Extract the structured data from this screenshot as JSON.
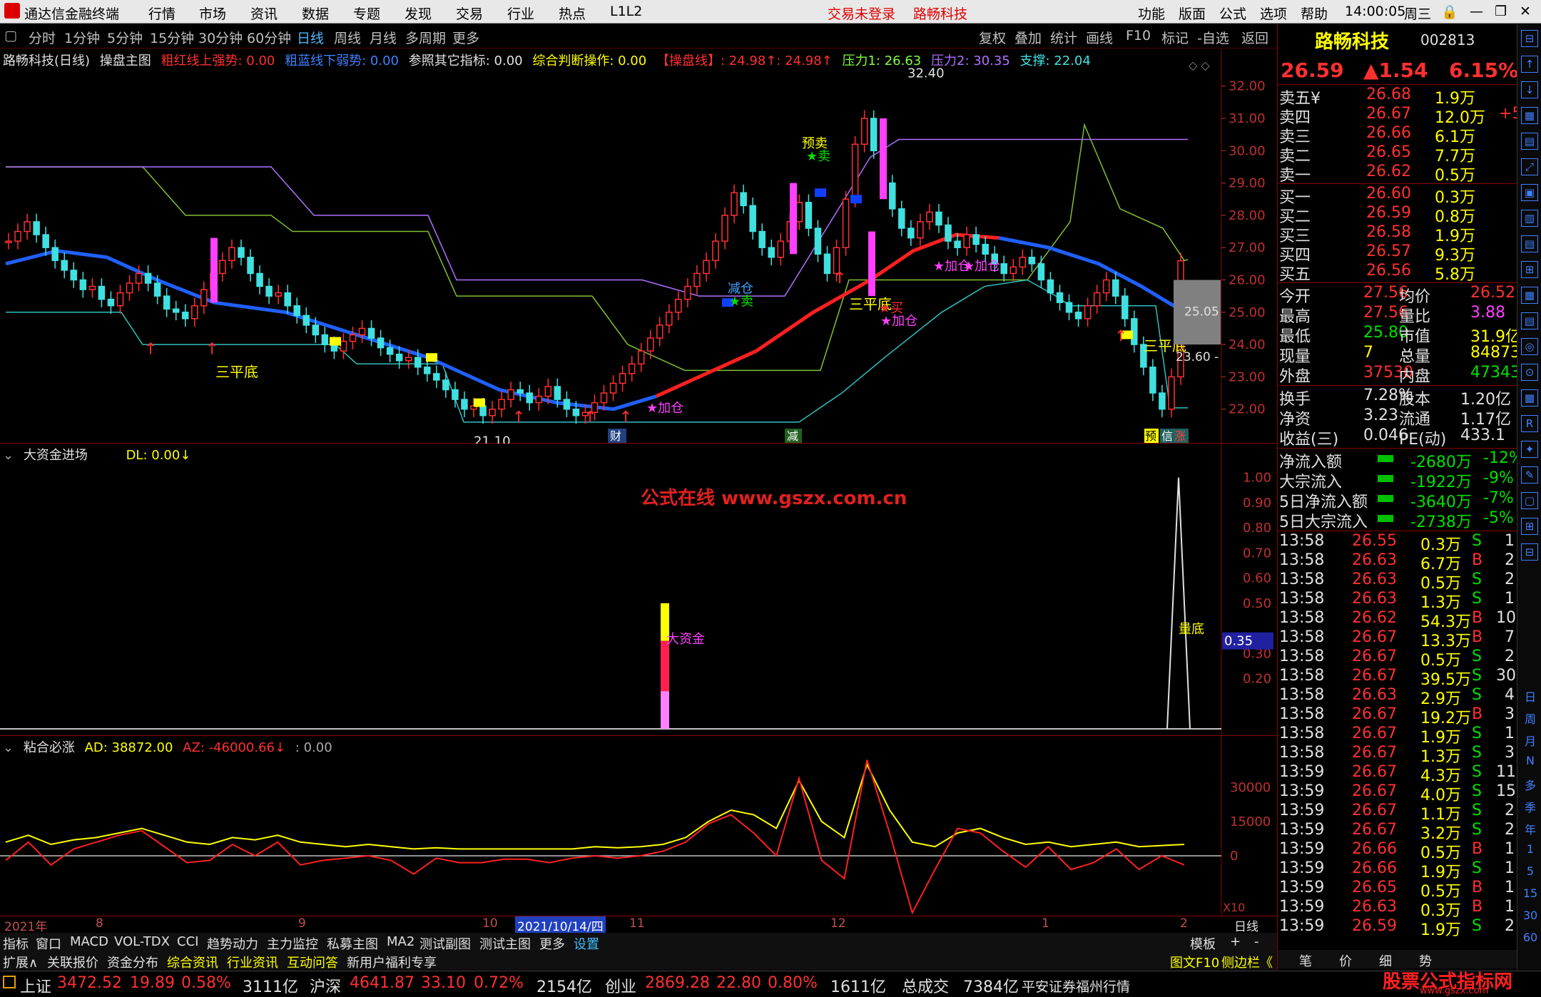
{
  "app": {
    "title": "通达信金融终端",
    "menu": [
      "行情",
      "市场",
      "资讯",
      "数据",
      "专题",
      "发现",
      "交易",
      "行业",
      "热点",
      "L1L2"
    ],
    "center_status": "交易未登录",
    "center_stock": "路畅科技",
    "right_menu": [
      "功能",
      "版面",
      "公式",
      "选项",
      "帮助"
    ],
    "clock": "14:00:05",
    "weekday": "周三"
  },
  "toolbar": {
    "periods": [
      "分时",
      "1分钟",
      "5分钟",
      "15分钟",
      "30分钟",
      "60分钟",
      "日线",
      "周线",
      "月线",
      "多周期",
      "更多"
    ],
    "active": "日线",
    "right": [
      "复权",
      "叠加",
      "统计",
      "画线",
      "F10",
      "标记",
      "-自选",
      "返回"
    ]
  },
  "main": {
    "header": {
      "name": "路畅科技(日线)",
      "indicator": "操盘主图",
      "l1": "粗红线上强势: 0.00",
      "l2": "粗蓝线下弱势: 0.00",
      "l3": "参照其它指标: 0.00",
      "l4": "综合判断操作: 0.00",
      "l5": "【操盘线】: 24.98↑: 24.98↑",
      "p1": "压力1: 26.63",
      "p2": "压力2: 30.35",
      "s1": "支撑: 22.04"
    },
    "y_ticks": [
      "32.00",
      "31.00",
      "30.00",
      "29.00",
      "28.00",
      "27.00",
      "26.00",
      "25.00",
      "24.00",
      "23.00",
      "22.00"
    ],
    "y_range": [
      21.0,
      32.7
    ],
    "labels": {
      "high": "32.40",
      "low": "21.10",
      "sanpingdi": "三平底",
      "yumai": "预卖",
      "mai": "卖",
      "jiancang": "减仓",
      "mai2": "买",
      "jiacang": "加仓",
      "cai": "财",
      "jian": "减",
      "yu": "预",
      "xin": "信",
      "zhang": "涨",
      "price_box": "25.05",
      "price_low": "23.60 -"
    }
  },
  "sub1": {
    "title": "大资金进场",
    "dl": "DL: 0.00↓",
    "watermark": "公式在线 www.gszx.com.cn",
    "y_ticks": [
      "1.00",
      "0.90",
      "0.80",
      "0.70",
      "0.60",
      "0.50",
      "0.35",
      "0.30",
      "0.20"
    ],
    "marker": "0.35",
    "bigfund": "大资金",
    "liangdi": "量底"
  },
  "sub2": {
    "title": "粘合必涨",
    "ad": "AD: 38872.00",
    "az": "AZ: -46000.66↓",
    "z": ": 0.00",
    "y_ticks": [
      "30000",
      "15000",
      "0"
    ],
    "x10": "X10"
  },
  "dateaxis": {
    "labels": [
      "2021年",
      "8",
      "9",
      "10",
      "2021/10/14/四",
      "11",
      "12",
      "1",
      "2"
    ],
    "right": "日线"
  },
  "tabs1": [
    "指标",
    "窗口",
    "MACD",
    "VOL-TDX",
    "CCI",
    "趋势动力",
    "主力监控",
    "私募主图",
    "MA2",
    "测试副图",
    "测试主图",
    "更多",
    "设置"
  ],
  "tabs1_right": [
    "模板",
    "+",
    "-"
  ],
  "tabs2": [
    "扩展∧",
    "关联报价",
    "资金分布",
    "综合资讯",
    "行业资讯",
    "互动问答",
    "新用户福利专享"
  ],
  "tabs2_right": [
    "图文F10",
    "侧边栏《"
  ],
  "quote": {
    "name": "路畅科技",
    "code": "002813",
    "price": "26.59",
    "change": "▲1.54",
    "pct": "6.15%",
    "asks": [
      [
        "卖五",
        "26.68",
        "1.9万"
      ],
      [
        "卖四",
        "26.67",
        "12.0万"
      ],
      [
        "卖三",
        "26.66",
        "6.1万"
      ],
      [
        "卖二",
        "26.65",
        "7.7万"
      ],
      [
        "卖一",
        "26.62",
        "0.5万"
      ]
    ],
    "ask_extra": "+5",
    "bids": [
      [
        "买一",
        "26.60",
        "0.3万"
      ],
      [
        "买二",
        "26.59",
        "0.8万"
      ],
      [
        "买三",
        "26.58",
        "1.9万"
      ],
      [
        "买四",
        "26.57",
        "9.3万"
      ],
      [
        "买五",
        "26.56",
        "5.8万"
      ]
    ],
    "stats": [
      [
        "今开",
        "27.56",
        "均价",
        "26.52"
      ],
      [
        "最高",
        "27.56",
        "量比",
        "3.88"
      ],
      [
        "最低",
        "25.80",
        "市值",
        "31.9亿"
      ],
      [
        "现量",
        "7",
        "总量",
        "84873"
      ],
      [
        "外盘",
        "37530",
        "内盘",
        "47343"
      ]
    ],
    "stats2": [
      [
        "换手",
        "7.28%",
        "股本",
        "1.20亿"
      ],
      [
        "净资",
        "3.23",
        "流通",
        "1.17亿"
      ],
      [
        "收益(三)",
        "0.046",
        "PE(动)",
        "433.1"
      ]
    ],
    "flows": [
      [
        "净流入额",
        "-2680万",
        "-12%"
      ],
      [
        "大宗流入",
        "-1922万",
        "-9%"
      ],
      [
        "5日净流入额",
        "-3640万",
        "-7%"
      ],
      [
        "5日大宗流入",
        "-2738万",
        "-5%"
      ]
    ],
    "ticks": [
      [
        "13:58",
        "26.55",
        "0.3万",
        "S",
        "1"
      ],
      [
        "13:58",
        "26.63",
        "6.7万",
        "B",
        "2"
      ],
      [
        "13:58",
        "26.63",
        "0.5万",
        "S",
        "2"
      ],
      [
        "13:58",
        "26.63",
        "1.3万",
        "S",
        "1"
      ],
      [
        "13:58",
        "26.62",
        "54.3万",
        "B",
        "10"
      ],
      [
        "13:58",
        "26.67",
        "13.3万",
        "B",
        "7"
      ],
      [
        "13:58",
        "26.67",
        "0.5万",
        "S",
        "2"
      ],
      [
        "13:58",
        "26.67",
        "39.5万",
        "S",
        "30"
      ],
      [
        "13:58",
        "26.63",
        "2.9万",
        "S",
        "4"
      ],
      [
        "13:58",
        "26.67",
        "19.2万",
        "B",
        "3"
      ],
      [
        "13:58",
        "26.67",
        "1.9万",
        "S",
        "1"
      ],
      [
        "13:58",
        "26.67",
        "1.3万",
        "S",
        "3"
      ],
      [
        "13:59",
        "26.67",
        "4.3万",
        "S",
        "11"
      ],
      [
        "13:59",
        "26.67",
        "4.0万",
        "S",
        "15"
      ],
      [
        "13:59",
        "26.67",
        "1.1万",
        "S",
        "2"
      ],
      [
        "13:59",
        "26.67",
        "3.2万",
        "S",
        "2"
      ],
      [
        "13:59",
        "26.66",
        "0.5万",
        "B",
        "1"
      ],
      [
        "13:59",
        "26.66",
        "1.9万",
        "S",
        "1"
      ],
      [
        "13:59",
        "26.65",
        "0.5万",
        "B",
        "1"
      ],
      [
        "13:59",
        "26.63",
        "0.3万",
        "B",
        "1"
      ],
      [
        "13:59",
        "26.59",
        "1.9万",
        "S",
        "2"
      ]
    ],
    "bottom_tabs": [
      "笔",
      "价",
      "细",
      "势"
    ]
  },
  "side": [
    "日",
    "周",
    "月",
    "N",
    "多",
    "季",
    "年",
    "1",
    "5",
    "15",
    "30",
    "60"
  ],
  "status": {
    "idx1": [
      "上证",
      "3472.52",
      "19.89",
      "0.58%",
      "3111亿"
    ],
    "idx2": [
      "沪深",
      "4641.87",
      "33.10",
      "0.72%",
      "2154亿"
    ],
    "idx3": [
      "创业",
      "2869.28",
      "22.80",
      "0.80%",
      "1611亿"
    ],
    "vol": [
      "总成交",
      "7384亿"
    ],
    "broker": "平安证券福州行情",
    "brand": "股票公式指标网",
    "brand_url": "www.gszx.com"
  },
  "colors": {
    "up": "#ff3030",
    "down": "#40e0e0",
    "ma_blue": "#2060ff",
    "ma_red": "#ff2020",
    "yellow": "#ffff00",
    "magenta": "#ff40ff"
  }
}
